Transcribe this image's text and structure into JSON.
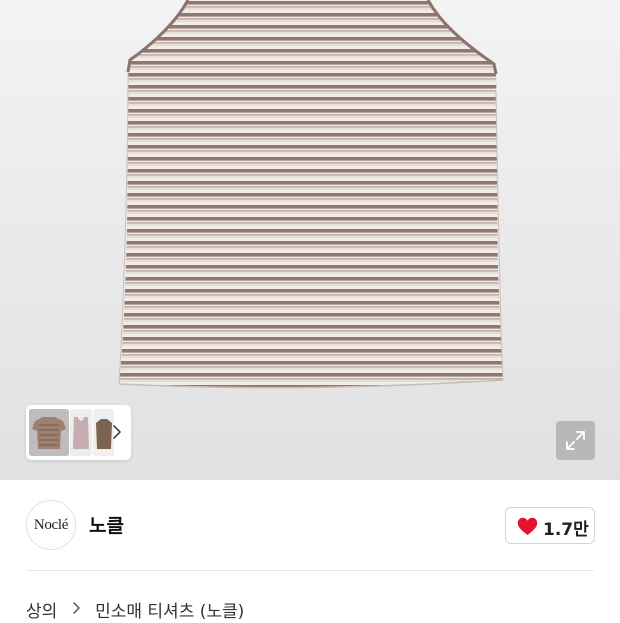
{
  "brand": {
    "logo_text": "Noclé",
    "name": "노클"
  },
  "like": {
    "count": "1.7만",
    "color": "#e8112d"
  },
  "breadcrumb": {
    "category": "상의",
    "subcategory": "민소매 티셔츠 (노클)"
  },
  "colors": {
    "stripe_dark": "#8e7871",
    "stripe_light": "#f2ece6"
  },
  "icons": {
    "expand": "expand-icon",
    "thumb_next": "chevron-right-icon",
    "crumb_sep": "chevron-right-icon",
    "like": "heart-icon"
  }
}
